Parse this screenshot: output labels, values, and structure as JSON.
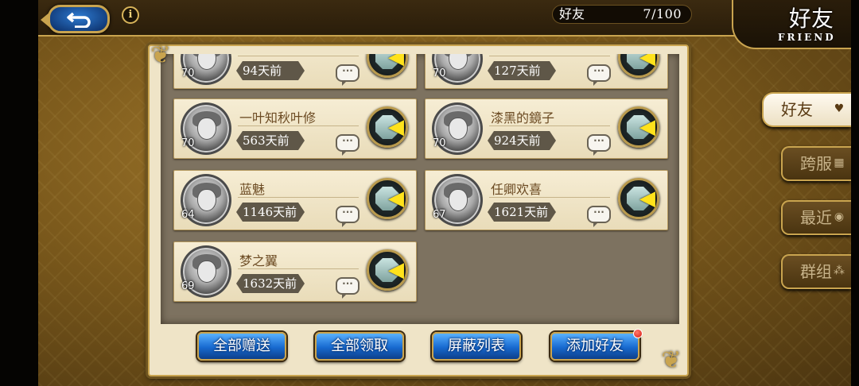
{
  "header": {
    "back_icon": "back-arrow-icon",
    "info_icon": "i",
    "friend_count_label": "好友",
    "friend_count_value": "7/100",
    "title": "好友",
    "title_en": "FRIEND"
  },
  "friends": [
    {
      "level": "70",
      "name": "",
      "last_login": "94天前"
    },
    {
      "level": "70",
      "name": "",
      "last_login": "127天前"
    },
    {
      "level": "70",
      "name": "一叶知秋叶修",
      "last_login": "563天前"
    },
    {
      "level": "70",
      "name": "漆黑的鏡子",
      "last_login": "924天前"
    },
    {
      "level": "64",
      "name": "蓝魅",
      "last_login": "1146天前"
    },
    {
      "level": "67",
      "name": "任卿欢喜",
      "last_login": "1621天前"
    },
    {
      "level": "69",
      "name": "梦之翼",
      "last_login": "1632天前"
    }
  ],
  "chat_icon_text": "···",
  "gift_icon_arrow": "◀",
  "actions": {
    "send_all": "全部赠送",
    "receive_all": "全部领取",
    "block_list": "屏蔽列表",
    "add_friend": "添加好友"
  },
  "side_tabs": {
    "friends": "好友",
    "cross_server": "跨服",
    "recent": "最近",
    "group": "群组"
  },
  "colors": {
    "accent_gold": "#c9a44f",
    "button_blue": "#1769cf",
    "notify_red": "#d8160c"
  }
}
